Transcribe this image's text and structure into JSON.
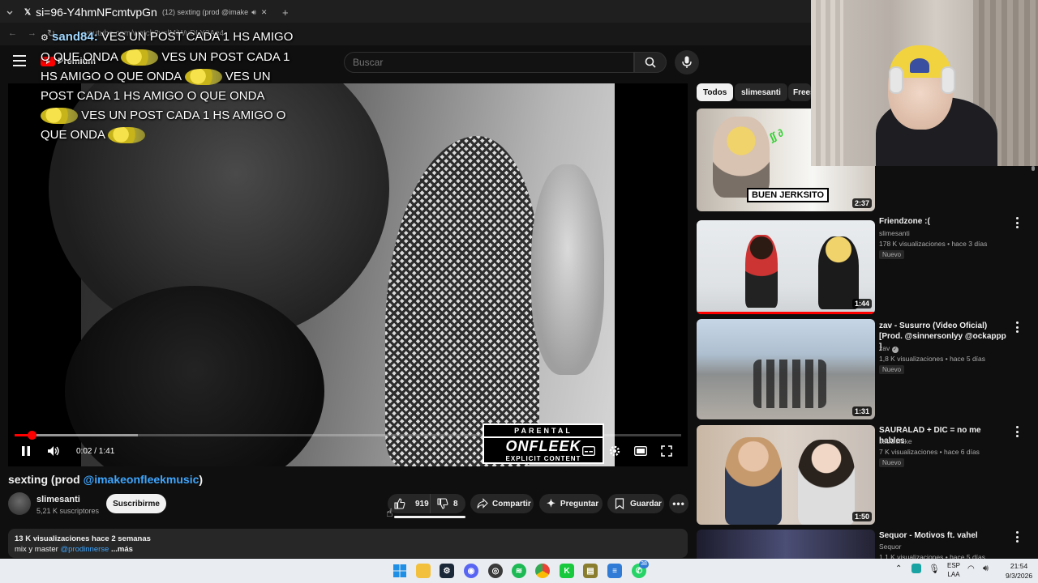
{
  "browser": {
    "tabs": [
      {
        "label": "si=96-Y4hmNFcmtvpGn"
      },
      {
        "label": "(12) sexting (prod @imake"
      }
    ],
    "new_tab_label": "+",
    "url": "youtube.com/watch?v=lMiWuDLY3Ae4"
  },
  "chat_overlay": {
    "username": "sand84:",
    "message": "VES UN POST CADA 1 HS AMIGO O QUE ONDA",
    "emote": "cat-emote"
  },
  "header": {
    "logo_text": "Premium",
    "search_placeholder": "Buscar"
  },
  "player": {
    "time": "0:02 / 1:41",
    "progress_fraction": 0.025,
    "buffered_fraction": 0.185,
    "parental": {
      "line1": "PARENTAL",
      "line2": "ONFLEEK",
      "line3": "EXPLICIT CONTENT"
    }
  },
  "video": {
    "title_prefix": "sexting (prod ",
    "title_link": "@imakeonfleekmusic",
    "title_suffix": ")",
    "channel": "slimesanti",
    "subscribers": "5,21 K suscriptores",
    "subscribe_label": "Suscribirme",
    "likes": "919",
    "dislikes": "8",
    "share_label": "Compartir",
    "ask_label": "Preguntar",
    "save_label": "Guardar",
    "description": {
      "stats": "13 K visualizaciones  hace 2 semanas",
      "line2_prefix": "mix y master ",
      "line2_link": "@prodinnerse",
      "more": " ...más"
    }
  },
  "sidebar": {
    "chips": [
      "Todos",
      "slimesanti",
      "Frees"
    ],
    "recommendations": [
      {
        "title": "",
        "channel": "",
        "meta": "",
        "badge": "",
        "duration": "2:37",
        "thumb_text": "BUEN JERKSITO"
      },
      {
        "title": "Friendzone :(",
        "channel": "slimesanti",
        "meta": "178 K visualizaciones • hace 3 días",
        "badge": "Nuevo",
        "duration": "1:44"
      },
      {
        "title": "zav - Susurro (Video Oficial) [Prod. @sinnersonlyy @ockappp ]",
        "channel": "zav",
        "meta": "1,8 K visualizaciones • hace 5 días",
        "badge": "Nuevo",
        "duration": "1:31"
      },
      {
        "title": "SAURALAD + DIC = no me hables",
        "channel": "saddicfake",
        "meta": "7 K visualizaciones • hace 6 días",
        "badge": "Nuevo",
        "duration": "1:50"
      },
      {
        "title": "Sequor - Motivos ft. vahel",
        "channel": "Sequor",
        "meta": "1,1 K visualizaciones • hace 5 días",
        "badge": "",
        "duration": ""
      }
    ]
  },
  "taskbar": {
    "language": "ESP",
    "layout": "LAA",
    "time": "21:54",
    "date": "9/3/2026",
    "whatsapp_badge": "38"
  },
  "colors": {
    "background": "#0f0f0f",
    "accent_red": "#ff0000",
    "link_blue": "#3ea6ff",
    "surface": "#272727"
  }
}
